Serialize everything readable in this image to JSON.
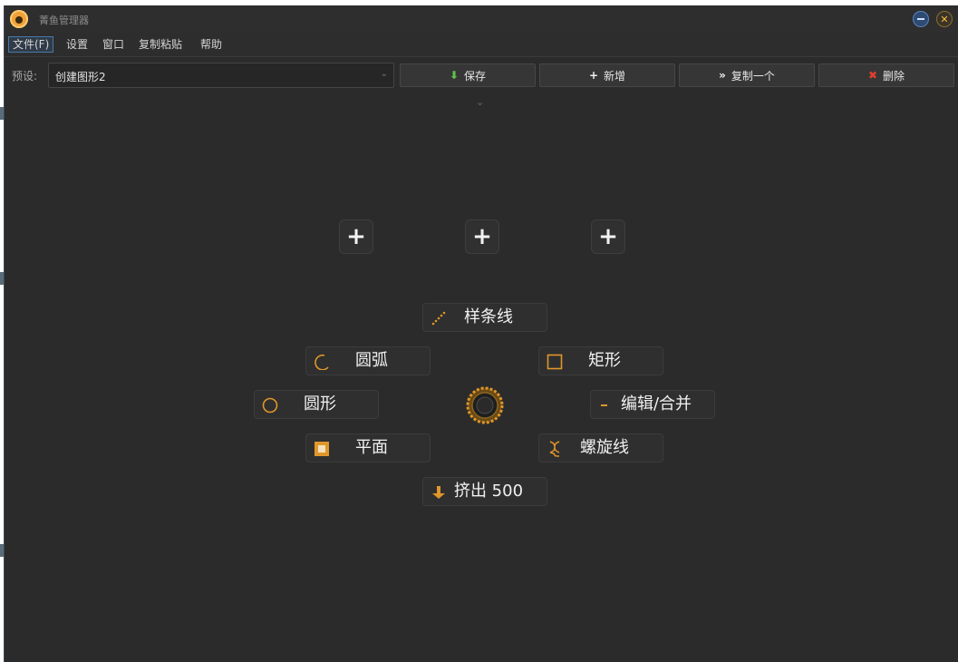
{
  "window": {
    "title": "菁鱼管理器"
  },
  "menu": {
    "items": [
      "文件(F)",
      "设置",
      "窗口",
      "复制粘贴",
      "帮助"
    ]
  },
  "toolbar": {
    "preset_label": "预设:",
    "preset_value": "创建图形2",
    "buttons": [
      {
        "label": "保存",
        "icon": "down-arrow-icon",
        "color": "#5fc24a"
      },
      {
        "label": "新增",
        "icon": "plus-icon",
        "color": "#f0f0f0"
      },
      {
        "label": "复制一个",
        "icon": "double-chevron-icon",
        "color": "#f0f0f0"
      },
      {
        "label": "删除",
        "icon": "x-icon",
        "color": "#e0402a"
      }
    ]
  },
  "plus_buttons": [
    "+",
    "+",
    "+"
  ],
  "radial_menu": {
    "accent": "#e0962a",
    "items": [
      {
        "label": "样条线",
        "icon": "spline-icon"
      },
      {
        "label": "圆弧",
        "icon": "arc-icon"
      },
      {
        "label": "矩形",
        "icon": "rectangle-icon"
      },
      {
        "label": "圆形",
        "icon": "circle-icon"
      },
      {
        "label": "编辑/合并",
        "icon": "minus-icon"
      },
      {
        "label": "平面",
        "icon": "plane-icon"
      },
      {
        "label": "螺旋线",
        "icon": "helix-icon"
      },
      {
        "label": "挤出 500",
        "icon": "extrude-icon"
      }
    ]
  }
}
